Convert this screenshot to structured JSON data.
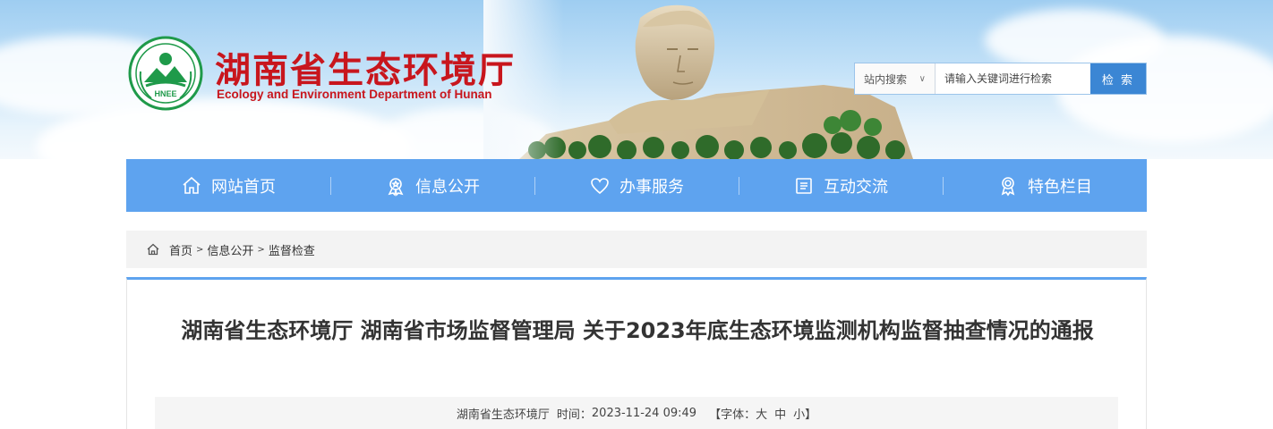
{
  "header": {
    "title": "湖南省生态环境厅",
    "subtitle": "Ecology and Environment Department of Hunan",
    "logo_text": "HNEE",
    "logo_color": "#1f9a4a",
    "title_color": "#c8161d"
  },
  "search": {
    "scope": "站内搜索",
    "placeholder": "请输入关键词进行检索",
    "button": "检 索"
  },
  "nav": {
    "color": "#5ea3ef",
    "items": [
      {
        "label": "网站首页",
        "icon": "home-icon"
      },
      {
        "label": "信息公开",
        "icon": "badge-icon"
      },
      {
        "label": "办事服务",
        "icon": "heart-icon"
      },
      {
        "label": "互动交流",
        "icon": "list-icon"
      },
      {
        "label": "特色栏目",
        "icon": "award-icon"
      }
    ]
  },
  "breadcrumb": {
    "items": [
      "首页",
      "信息公开",
      "监督检查"
    ],
    "separator": ">"
  },
  "article": {
    "title": "湖南省生态环境厅 湖南省市场监督管理局 关于2023年底生态环境监测机构监督抽查情况的通报",
    "source": "湖南省生态环境厅",
    "time_label": "时间：",
    "time": "2023-11-24 09:49",
    "font_label": "【字体：",
    "font_large": "大",
    "font_medium": "中",
    "font_small": "小】"
  }
}
